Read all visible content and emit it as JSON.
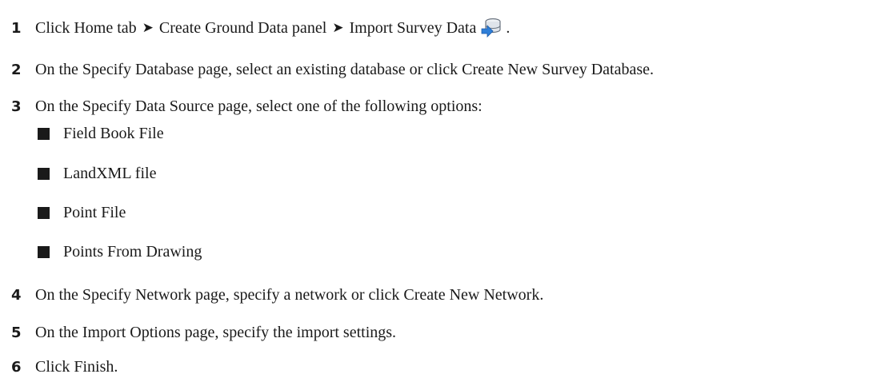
{
  "steps": [
    {
      "number": "1",
      "parts": [
        "Click Home tab",
        "Create Ground Data panel",
        "Import Survey Data"
      ],
      "separator": "➤",
      "trailing": ".",
      "icon": "import-survey-data-icon"
    },
    {
      "number": "2",
      "text": "On the Specify Database page, select an existing database or click Create New Survey Database."
    },
    {
      "number": "3",
      "text": "On the Specify Data Source page, select one of the following options:",
      "options": [
        "Field Book File",
        "LandXML file",
        "Point File",
        "Points From Drawing"
      ]
    },
    {
      "number": "4",
      "text": "On the Specify Network page, specify a network or click Create New Network."
    },
    {
      "number": "5",
      "text": "On the Import Options page, specify the import settings."
    },
    {
      "number": "6",
      "text": "Click Finish."
    }
  ]
}
